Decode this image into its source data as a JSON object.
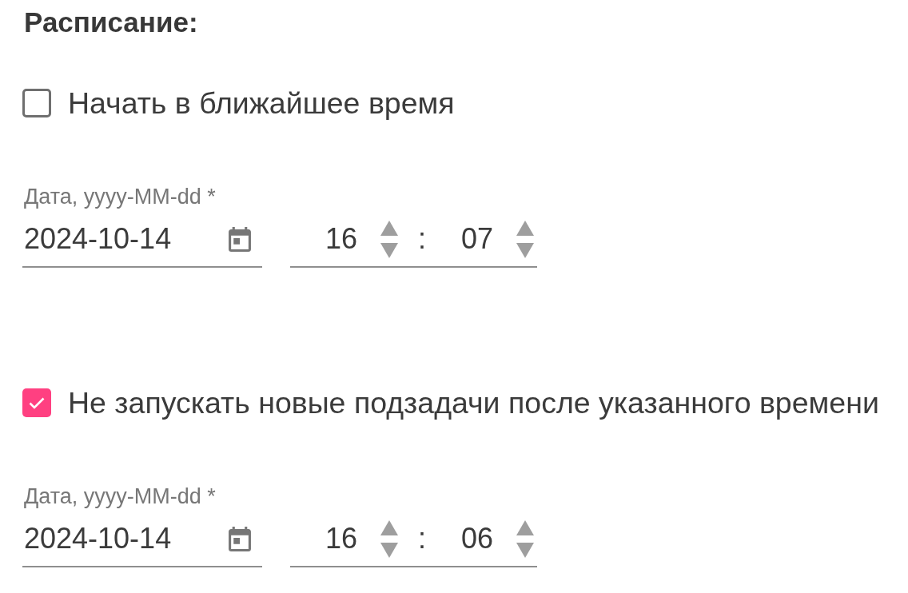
{
  "section_title": "Расписание:",
  "blocks": [
    {
      "checkbox": {
        "label": "Начать в ближайшее время",
        "checked": false
      },
      "date_field": {
        "label": "Дата, yyyy-MM-dd *",
        "value": "2024-10-14"
      },
      "time_field": {
        "hours": "16",
        "separator": ":",
        "minutes": "07"
      }
    },
    {
      "checkbox": {
        "label": "Не запускать новые подзадачи после указанного времени",
        "checked": true
      },
      "date_field": {
        "label": "Дата, yyyy-MM-dd *",
        "value": "2024-10-14"
      },
      "time_field": {
        "hours": "16",
        "separator": ":",
        "minutes": "06"
      }
    }
  ]
}
